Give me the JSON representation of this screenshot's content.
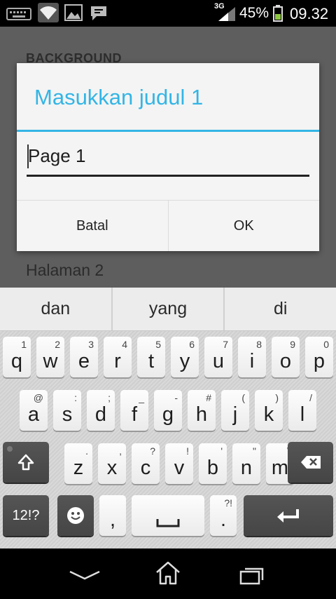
{
  "status_bar": {
    "network_type": "3G",
    "battery_percent": "45%",
    "time": "09.32",
    "icons": [
      "keyboard-icon",
      "wifi-icon",
      "gallery-icon",
      "message-icon",
      "signal-icon",
      "battery-icon"
    ]
  },
  "background": {
    "section_header": "BACKGROUND",
    "list_item": "Halaman 2"
  },
  "dialog": {
    "title": "Masukkan judul 1",
    "input_value": "Page 1",
    "cancel_label": "Batal",
    "ok_label": "OK",
    "accent_color": "#33b5e5"
  },
  "keyboard": {
    "suggestions": [
      "dan",
      "yang",
      "di"
    ],
    "row1": [
      {
        "ch": "q",
        "hint": "1"
      },
      {
        "ch": "w",
        "hint": "2"
      },
      {
        "ch": "e",
        "hint": "3"
      },
      {
        "ch": "r",
        "hint": "4"
      },
      {
        "ch": "t",
        "hint": "5"
      },
      {
        "ch": "y",
        "hint": "6"
      },
      {
        "ch": "u",
        "hint": "7"
      },
      {
        "ch": "i",
        "hint": "8"
      },
      {
        "ch": "o",
        "hint": "9"
      },
      {
        "ch": "p",
        "hint": "0"
      }
    ],
    "row2": [
      {
        "ch": "a",
        "hint": "@"
      },
      {
        "ch": "s",
        "hint": ":"
      },
      {
        "ch": "d",
        "hint": ";"
      },
      {
        "ch": "f",
        "hint": "_"
      },
      {
        "ch": "g",
        "hint": "-"
      },
      {
        "ch": "h",
        "hint": "#"
      },
      {
        "ch": "j",
        "hint": "("
      },
      {
        "ch": "k",
        "hint": ")"
      },
      {
        "ch": "l",
        "hint": "/"
      }
    ],
    "row3": [
      {
        "ch": "z",
        "hint": "."
      },
      {
        "ch": "x",
        "hint": ","
      },
      {
        "ch": "c",
        "hint": "?"
      },
      {
        "ch": "v",
        "hint": "!"
      },
      {
        "ch": "b",
        "hint": "'"
      },
      {
        "ch": "n",
        "hint": "\""
      },
      {
        "ch": "m",
        "hint": "\\"
      }
    ],
    "symbols_label": "12!?",
    "comma": ",",
    "period": ".",
    "period_hint": "?!"
  },
  "nav_bar": {
    "icons": [
      "back-icon",
      "home-icon",
      "recents-icon"
    ]
  }
}
